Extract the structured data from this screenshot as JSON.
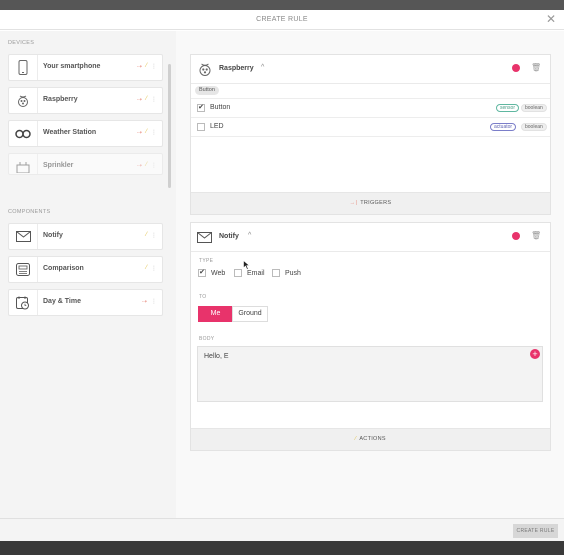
{
  "modal": {
    "title": "CREATE RULE",
    "close_glyph": "✕"
  },
  "sidebar": {
    "devices_label": "DEVICES",
    "components_label": "COMPONENTS",
    "devices": [
      {
        "label": "Your smartphone",
        "icon": "smartphone-icon"
      },
      {
        "label": "Raspberry",
        "icon": "raspberry-icon"
      },
      {
        "label": "Weather Station",
        "icon": "weather-station-icon"
      },
      {
        "label": "Sprinkler",
        "icon": "sprinkler-icon"
      }
    ],
    "components": [
      {
        "label": "Notify",
        "icon": "envelope-icon"
      },
      {
        "label": "Comparison",
        "icon": "comparison-icon"
      },
      {
        "label": "Day & Time",
        "icon": "calendar-clock-icon"
      }
    ],
    "glyphs": {
      "in": "⇢",
      "out": "⁄",
      "more": "⋮"
    }
  },
  "trigger_card": {
    "title": "Raspberry",
    "chevron": "^",
    "selected_chip": "Button",
    "rows": [
      {
        "label": "Button",
        "checked": true,
        "tags": [
          "sensor",
          "boolean"
        ]
      },
      {
        "label": "LED",
        "checked": false,
        "tags": [
          "actuator",
          "boolean"
        ]
      }
    ],
    "footer_label": "TRIGGERS",
    "footer_glyph": "→|"
  },
  "action_card": {
    "title": "Notify",
    "chevron": "^",
    "type_label": "TYPE",
    "type_options": [
      {
        "label": "Web",
        "checked": true
      },
      {
        "label": "Email",
        "checked": false
      },
      {
        "label": "Push",
        "checked": false
      }
    ],
    "to_label": "TO",
    "to_options": [
      {
        "label": "Me",
        "active": true
      },
      {
        "label": "Ground",
        "active": false
      }
    ],
    "body_label": "BODY",
    "body_value": "Hello, E",
    "plus_glyph": "+",
    "footer_label": "ACTIONS"
  },
  "footer": {
    "create_label": "CREATE RULE"
  },
  "colors": {
    "accent": "#e8336b",
    "sensor": "#4a9c86",
    "actuator": "#6165b3"
  }
}
